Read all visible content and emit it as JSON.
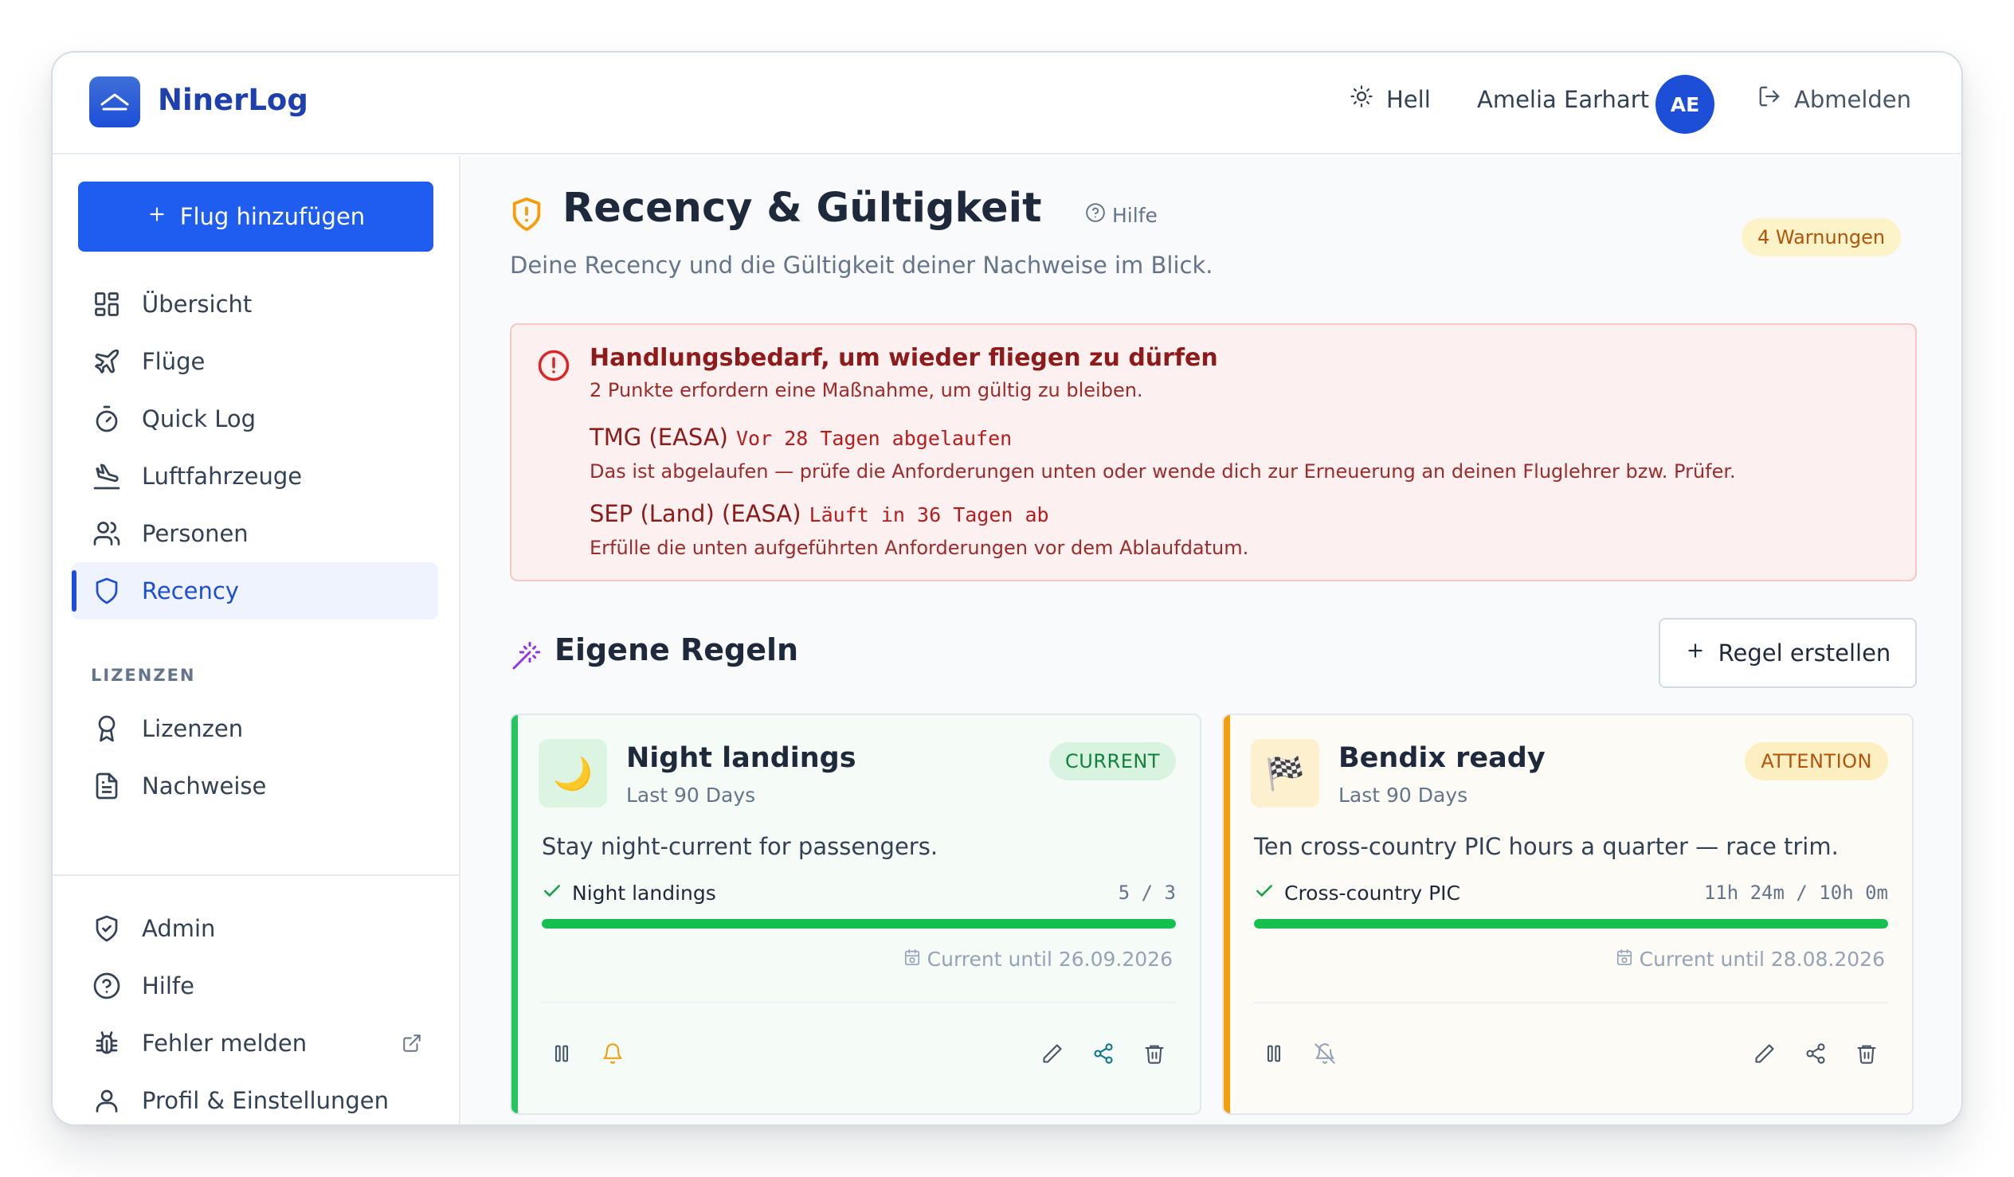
{
  "app": {
    "brand": "NinerLog"
  },
  "header": {
    "theme_label": "Hell",
    "user_name": "Amelia Earhart",
    "avatar_initials": "AE",
    "logout_label": "Abmelden"
  },
  "sidebar": {
    "add_flight_label": "Flug hinzufügen",
    "items": [
      {
        "label": "Übersicht",
        "icon": "dashboard-icon"
      },
      {
        "label": "Flüge",
        "icon": "plane-icon"
      },
      {
        "label": "Quick Log",
        "icon": "stopwatch-icon"
      },
      {
        "label": "Luftfahrzeuge",
        "icon": "plane-landing-icon"
      },
      {
        "label": "Personen",
        "icon": "users-icon"
      },
      {
        "label": "Recency",
        "icon": "shield-icon",
        "active": true
      }
    ],
    "section_label": "LIZENZEN",
    "license_items": [
      {
        "label": "Lizenzen",
        "icon": "award-icon"
      },
      {
        "label": "Nachweise",
        "icon": "document-icon"
      }
    ],
    "bottom_items": [
      {
        "label": "Admin",
        "icon": "shield-check-icon"
      },
      {
        "label": "Hilfe",
        "icon": "help-circle-icon"
      },
      {
        "label": "Fehler melden",
        "icon": "bug-icon"
      },
      {
        "label": "Profil & Einstellungen",
        "icon": "user-icon"
      }
    ]
  },
  "page": {
    "title": "Recency & Gültigkeit",
    "help_label": "Hilfe",
    "subtitle": "Deine Recency und die Gültigkeit deiner Nachweise im Blick.",
    "warnings_badge": "4 Warnungen"
  },
  "alert": {
    "title": "Handlungsbedarf, um wieder fliegen zu dürfen",
    "subtitle": "2 Punkte erfordern eine Maßnahme, um gültig zu bleiben.",
    "items": [
      {
        "name": "TMG (EASA)",
        "status": "Vor 28 Tagen abgelaufen",
        "description": "Das ist abgelaufen — prüfe die Anforderungen unten oder wende dich zur Erneuerung an deinen Fluglehrer bzw. Prüfer."
      },
      {
        "name": "SEP (Land) (EASA)",
        "status": "Läuft in 36 Tagen ab",
        "description": "Erfülle die unten aufgeführten Anforderungen vor dem Ablaufdatum."
      }
    ]
  },
  "rules": {
    "title": "Eigene Regeln",
    "create_label": "Regel erstellen",
    "cards": [
      {
        "emoji": "🌙",
        "title": "Night landings",
        "period": "Last 90 Days",
        "status": "CURRENT",
        "description": "Stay night-current for passengers.",
        "requirement_label": "Night landings",
        "requirement_value": "5 / 3",
        "progress": 1.0,
        "current_until": "Current until 26.09.2026",
        "accent_color": "#22c55e"
      },
      {
        "emoji": "🏁",
        "title": "Bendix ready",
        "period": "Last 90 Days",
        "status": "ATTENTION",
        "description": "Ten cross-country PIC hours a quarter — race trim.",
        "requirement_label": "Cross-country PIC",
        "requirement_value": "11h 24m / 10h 0m",
        "progress": 1.0,
        "current_until": "Current until 28.08.2026",
        "accent_color": "#f59e0b"
      }
    ]
  }
}
